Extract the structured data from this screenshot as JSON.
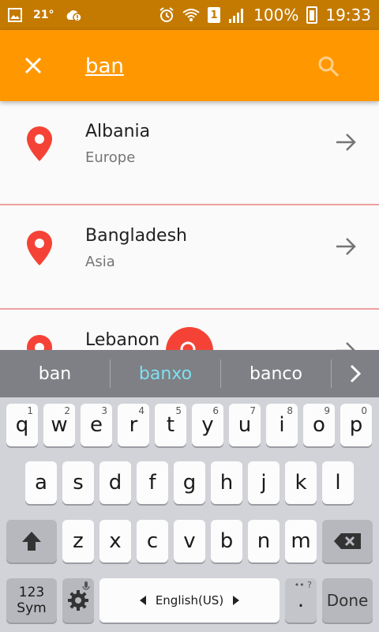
{
  "status_bar": {
    "temperature": "21°",
    "sim": "1",
    "battery": "100%",
    "time": "19:33"
  },
  "app_bar": {
    "search_value": "ban",
    "colors": {
      "bar": "#ff9800",
      "status": "#c47a00"
    }
  },
  "results": [
    {
      "name": "Albania",
      "region": "Europe"
    },
    {
      "name": "Bangladesh",
      "region": "Asia"
    },
    {
      "name": "Lebanon",
      "region": ""
    }
  ],
  "keyboard": {
    "suggestions": [
      "ban",
      "banxo",
      "banco"
    ],
    "row1": [
      {
        "key": "q",
        "hint": "1"
      },
      {
        "key": "w",
        "hint": "2"
      },
      {
        "key": "e",
        "hint": "3"
      },
      {
        "key": "r",
        "hint": "4"
      },
      {
        "key": "t",
        "hint": "5"
      },
      {
        "key": "y",
        "hint": "6"
      },
      {
        "key": "u",
        "hint": "7"
      },
      {
        "key": "i",
        "hint": "8"
      },
      {
        "key": "o",
        "hint": "9"
      },
      {
        "key": "p",
        "hint": "0"
      }
    ],
    "row2": [
      "a",
      "s",
      "d",
      "f",
      "g",
      "h",
      "j",
      "k",
      "l"
    ],
    "row3": [
      "z",
      "x",
      "c",
      "v",
      "b",
      "n",
      "m"
    ],
    "sym_label_top": "123",
    "sym_label_bottom": "Sym",
    "language": "English(US)",
    "period": ".",
    "done": "Done"
  }
}
